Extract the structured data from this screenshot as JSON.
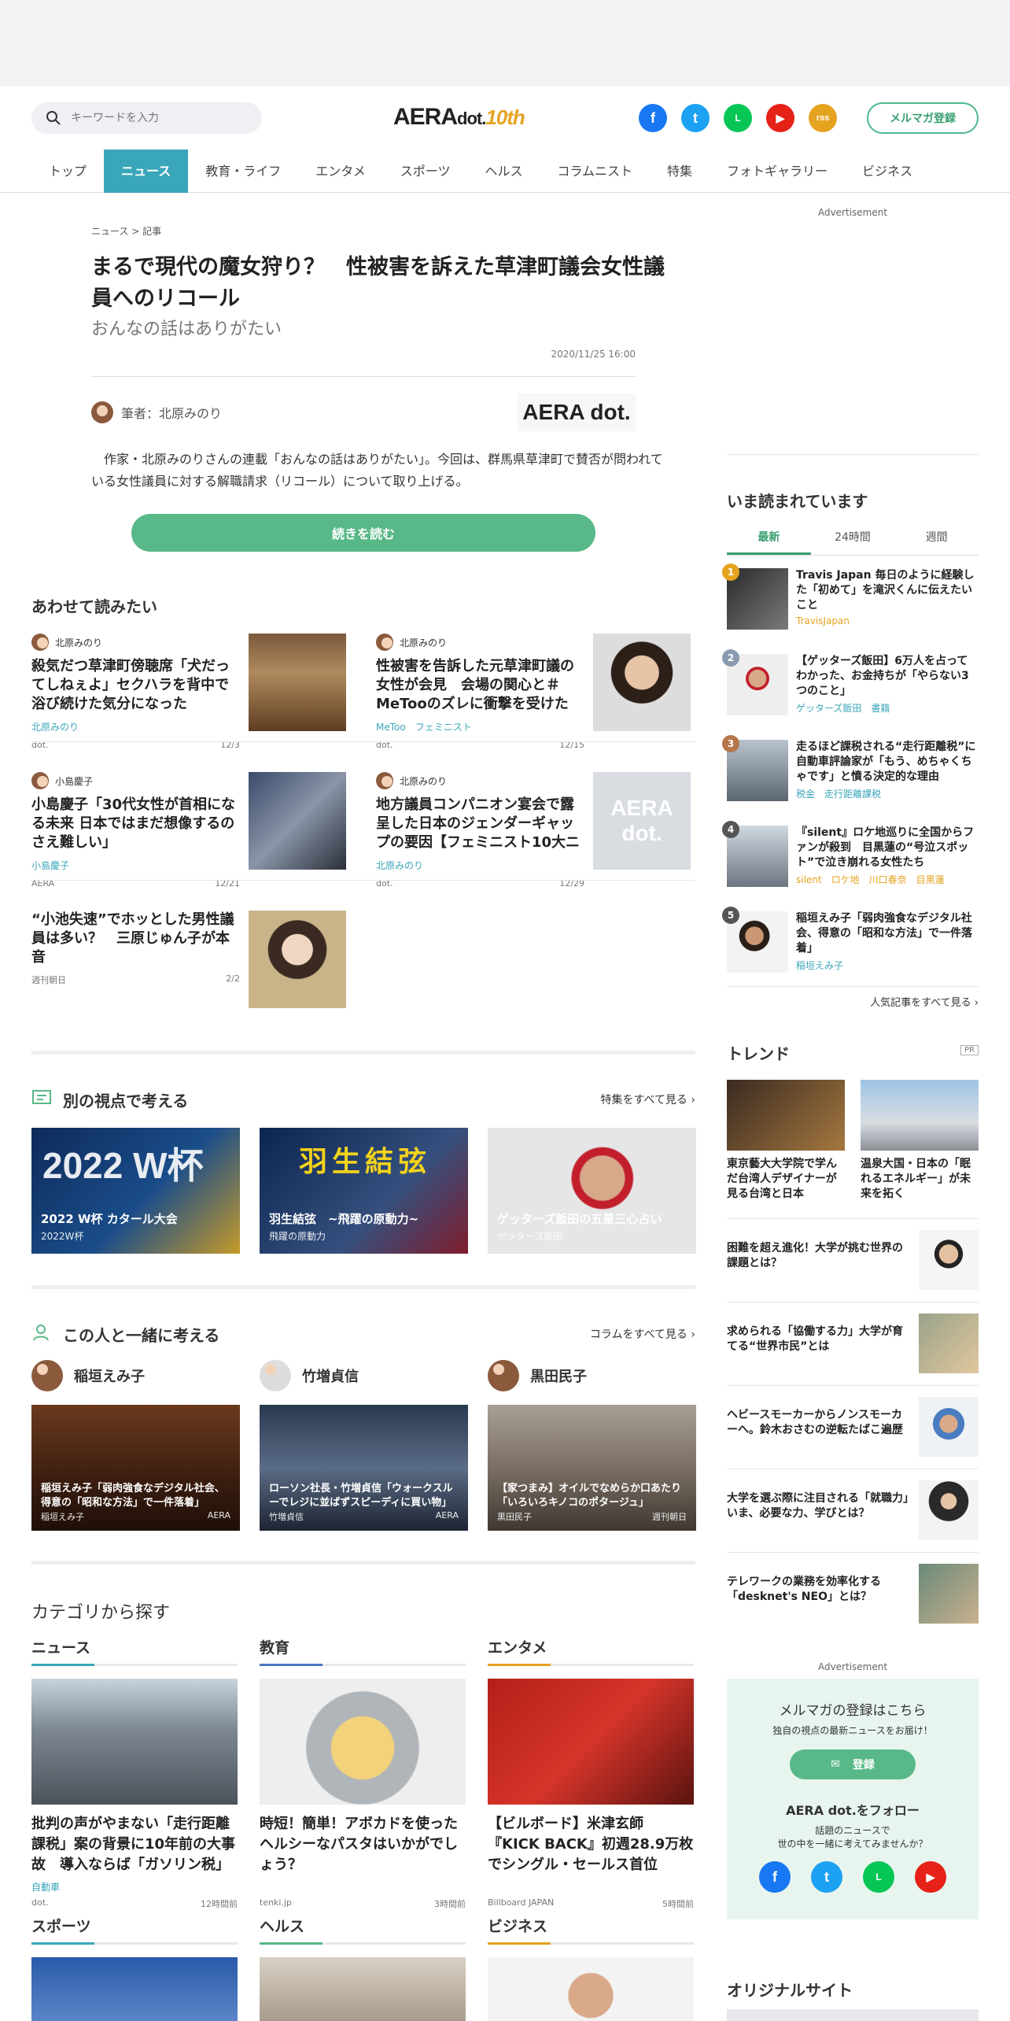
{
  "header": {
    "search_placeholder": "キーワードを入力",
    "logo_main": "AERA",
    "logo_dot": "dot.",
    "logo_badge": "10th",
    "mail_button": "メルマガ登録",
    "sns": [
      "f",
      "t",
      "L",
      "▶",
      "rss"
    ]
  },
  "nav": [
    "トップ",
    "ニュース",
    "教育・ライフ",
    "エンタメ",
    "スポーツ",
    "ヘルス",
    "コラムニスト",
    "特集",
    "フォトギャラリー",
    "ビジネス"
  ],
  "article": {
    "breadcrumb": "ニュース > 記事",
    "title": "まるで現代の魔女狩り？　性被害を訴えた草津町議会女性議員へのリコール",
    "subtitle": "おんなの話はありがたい",
    "date": "2020/11/25 16:00",
    "author": "筆者：北原みのり",
    "publisher_logo": "AERA dot.",
    "lead": "作家・北原みのりさんの連載「おんなの話はありがたい」。今回は、群馬県草津町で賛否が問われている女性議員に対する解職請求（リコール）について取り上げる。",
    "read_more": "続きを読む"
  },
  "related": {
    "title": "あわせて読みたい",
    "items": [
      {
        "author": "北原みのり",
        "title": "殺気だつ草津町傍聴席「犬だってしねぇよ」セクハラを背中で浴び続けた気分になった",
        "tags": "北原みのり",
        "source": "dot.",
        "date": "12/3"
      },
      {
        "author": "北原みのり",
        "title": "性被害を告訴した元草津町議の女性が会見　会場の関心と＃MeTooのズレに衝撃を受けた",
        "tags": "MeToo　フェミニスト",
        "source": "dot.",
        "date": "12/15"
      },
      {
        "author": "小島慶子",
        "title": "小島慶子「30代女性が首相になる未来 日本ではまだ想像するのさえ難しい」",
        "tags": "小島慶子",
        "source": "AERA",
        "date": "12/21"
      },
      {
        "author": "北原みのり",
        "title": "地方議員コンパニオン宴会で露呈した日本のジェンダーギャップの要因【フェミニスト10大ニュース】",
        "tags": "北原みのり",
        "source": "dot.",
        "date": "12/29"
      },
      {
        "author": "",
        "title": "“小池失速”でホッとした男性議員は多い？　三原じゅん子が本音",
        "tags": "",
        "source": "週刊朝日",
        "date": "2/2"
      }
    ],
    "placeholder_logo": "AERA dot."
  },
  "features": {
    "title": "別の視点で考える",
    "more": "特集をすべて見る",
    "items": [
      {
        "title": "2022 W杯 カタール大会",
        "sub": "2022W杯",
        "overlay": "2022 W杯"
      },
      {
        "title": "羽生結弦　~飛躍の原動力~",
        "sub": "飛躍の原動力",
        "overlay": "羽生結弦"
      },
      {
        "title": "ゲッターズ飯田の五星三心占い",
        "sub": "ゲッターズ飯田",
        "overlay": ""
      }
    ]
  },
  "people": {
    "title": "この人と一緒に考える",
    "more": "コラムをすべて見る",
    "items": [
      {
        "name": "稲垣えみ子",
        "title": "稲垣えみ子「弱肉強食なデジタル社会、得意の「昭和な方法」で一件落着」",
        "author": "稲垣えみ子",
        "source": "AERA"
      },
      {
        "name": "竹増貞信",
        "title": "ローソン社長・竹増貞信「ウォークスルーでレジに並ばずスピーディに買い物」",
        "author": "竹増貞信",
        "source": "AERA"
      },
      {
        "name": "黒田民子",
        "title": "【家つまみ】オイルでなめらか口あたり「いろいろキノコのポタージュ」",
        "author": "黒田民子",
        "source": "週刊朝日"
      }
    ]
  },
  "categories": {
    "title": "カテゴリから探す",
    "sections": [
      {
        "name": "ニュース",
        "color": "#3aa6b9",
        "title": "批判の声がやまない「走行距離課税」案の背景に10年前の大事故　導入ならば「ガソリン税」の見直しも",
        "tag": "自動車",
        "source": "dot.",
        "time": "12時間前"
      },
      {
        "name": "教育",
        "color": "#4a78c2",
        "title": "時短！簡単！アボカドを使ったヘルシーなパスタはいかがでしょう？",
        "tag": "",
        "source": "tenki.jp",
        "time": "3時間前"
      },
      {
        "name": "エンタメ",
        "color": "#e5a320",
        "title": "【ビルボード】米津玄師『KICK BACK』初週28.9万枚でシングル・セールス首位",
        "tag": "",
        "source": "Billboard JAPAN",
        "time": "5時間前"
      }
    ],
    "sections2": [
      {
        "name": "スポーツ",
        "color": "#3aa6b9"
      },
      {
        "name": "ヘルス",
        "color": "#58b887"
      },
      {
        "name": "ビジネス",
        "color": "#e5a320"
      }
    ]
  },
  "sidebar": {
    "ad_label": "Advertisement",
    "ranking_title": "いま読まれています",
    "tabs": [
      "最新",
      "24時間",
      "週間"
    ],
    "ranking": [
      {
        "num": "1",
        "title": "Travis Japan 毎日のように経験した「初めて」を滝沢くんに伝えたいこと",
        "tags": "TravisJapan",
        "color": "#e5a320"
      },
      {
        "num": "2",
        "title": "【ゲッターズ飯田】6万人を占ってわかった、お金持ちが「やらない3つのこと」",
        "tags": "ゲッターズ飯田　書籍",
        "color": "#8a9bb0"
      },
      {
        "num": "3",
        "title": "走るほど課税される“走行距離税”に自動車評論家が「もう、めちゃくちゃです」と憤る決定的な理由",
        "tags": "税金　走行距離課税",
        "color": "#b5764a"
      },
      {
        "num": "4",
        "title": "『silent』ロケ地巡りに全国からファンが殺到　目黒蓮の“号泣スポット”で泣き崩れる女性たち",
        "tags": "silent　ロケ地　川口春奈　目黒蓮",
        "color": "#555555"
      },
      {
        "num": "5",
        "title": "稲垣えみ子「弱肉強食なデジタル社会、得意の「昭和な方法」で一件落着」",
        "tags": "稲垣えみ子",
        "color": "#555555"
      }
    ],
    "ranking_more": "人気記事をすべて見る",
    "trend_title": "トレンド",
    "pr": "PR",
    "trend_top": [
      {
        "title": "東京藝大大学院で学んだ台湾人デザイナーが見る台湾と日本"
      },
      {
        "title": "温泉大国・日本の「眠れるエネルギー」が未来を拓く"
      }
    ],
    "trend_list": [
      "困難を超え進化！大学が挑む世界の課題とは？",
      "求められる「協働する力」大学が育てる“世界市民”とは",
      "ヘビースモーカーからノンスモーカーへ。鈴木おさむの逆転たばこ遍歴",
      "大学を選ぶ際に注目される「就職力」いま、必要な力、学びとは？",
      "テレワークの業務を効率化する「desknet's NEO」とは？"
    ],
    "mail_title": "メルマガの登録はこちら",
    "mail_sub": "独自の視点の最新ニュースをお届け！",
    "mail_button": "登録",
    "follow_title": "AERA dot.をフォロー",
    "follow_sub1": "話題のニュースで",
    "follow_sub2": "世の中を一緒に考えてみませんか？",
    "original_title": "オリジナルサイト"
  }
}
